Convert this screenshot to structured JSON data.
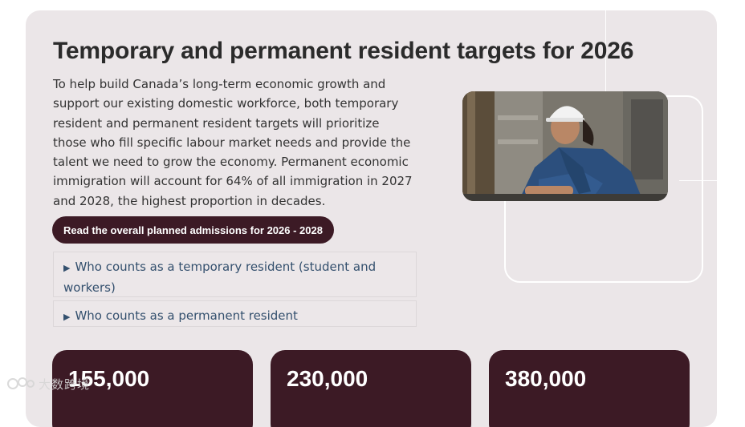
{
  "section": {
    "title": "Temporary and permanent resident targets for 2026",
    "paragraph": "To help build Canada’s long-term economic growth and support our existing domestic workforce, both temporary resident and permanent resident targets will prioritize those who fill specific labour market needs and provide the talent we need to grow the economy. Permanent economic immigration will account for 64% of all immigration in 2027 and 2028, the highest proportion in decades.",
    "cta_label": "Read the overall planned admissions for 2026 - 2028"
  },
  "accordions": [
    {
      "label": "Who counts as a temporary resident (student and workers)",
      "marker": "▶"
    },
    {
      "label": "Who counts as a permanent resident",
      "marker": "▶"
    }
  ],
  "stats": [
    {
      "value": "155,000"
    },
    {
      "value": "230,000"
    },
    {
      "value": "380,000"
    }
  ],
  "watermark": {
    "text": "大数跨境",
    "icon": "brand-logo-icon"
  },
  "colors": {
    "card_bg": "#ebe6e8",
    "accent_dark": "#3c1a25",
    "link_blue": "#34506e"
  }
}
